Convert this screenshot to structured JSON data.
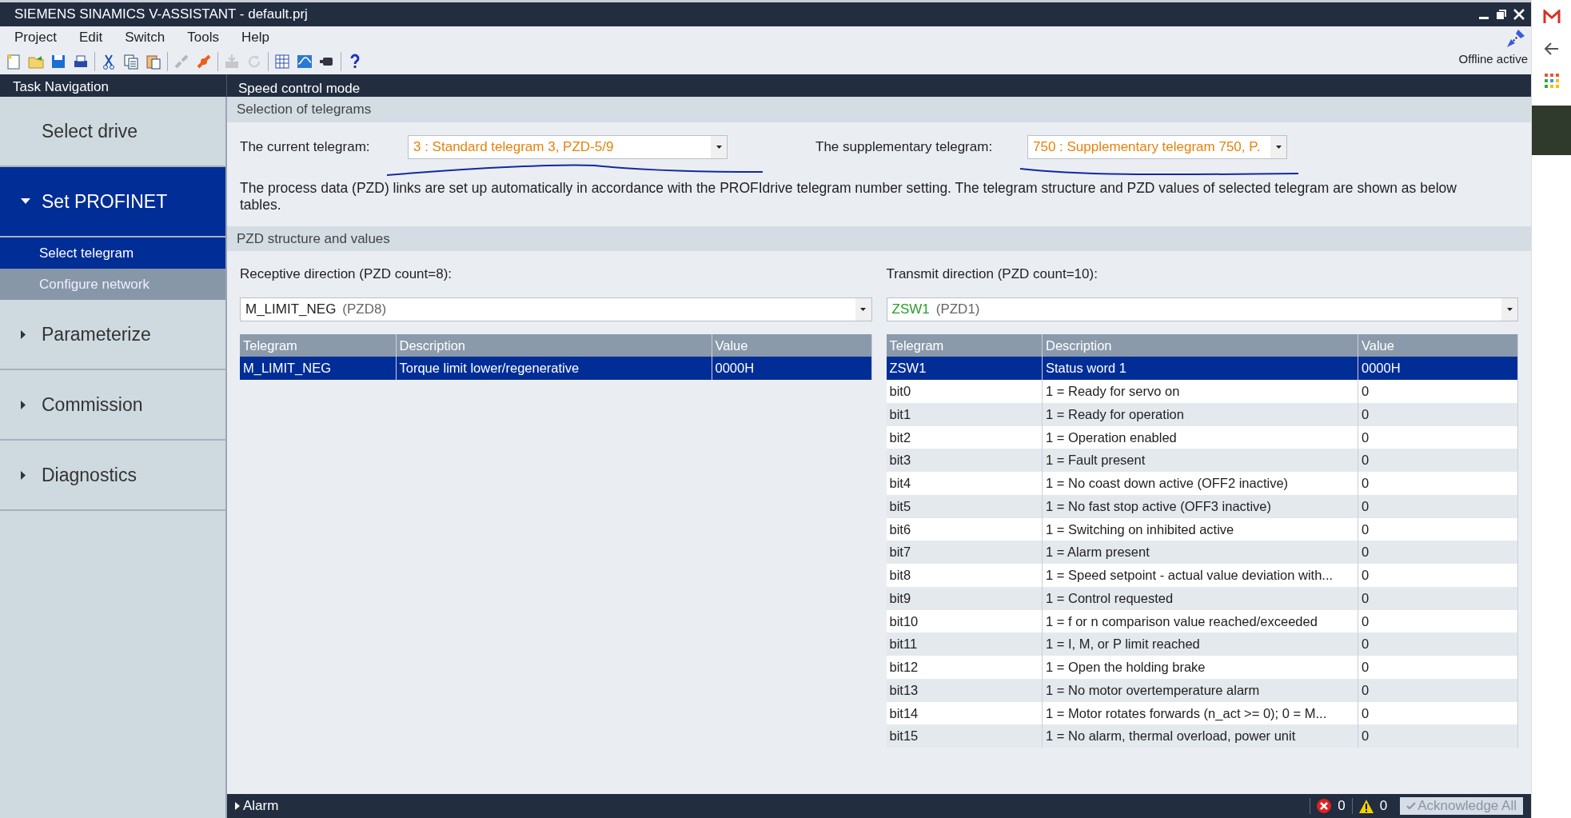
{
  "window": {
    "title": "SIEMENS SINAMICS V-ASSISTANT - default.prj"
  },
  "menu": [
    "Project",
    "Edit",
    "Switch",
    "Tools",
    "Help"
  ],
  "toolbar": [
    {
      "kind": "new",
      "disabled": false
    },
    {
      "kind": "open",
      "disabled": false
    },
    {
      "kind": "save",
      "disabled": false
    },
    {
      "kind": "print",
      "disabled": false
    },
    {
      "kind": "sep"
    },
    {
      "kind": "cut",
      "disabled": false
    },
    {
      "kind": "copy",
      "disabled": false
    },
    {
      "kind": "paste",
      "disabled": false
    },
    {
      "kind": "sep"
    },
    {
      "kind": "connect",
      "disabled": true
    },
    {
      "kind": "disconnect",
      "disabled": false
    },
    {
      "kind": "sep"
    },
    {
      "kind": "rom",
      "disabled": true
    },
    {
      "kind": "redo",
      "disabled": true
    },
    {
      "kind": "sep"
    },
    {
      "kind": "table",
      "disabled": false
    },
    {
      "kind": "trace",
      "disabled": false
    },
    {
      "kind": "motor",
      "disabled": false
    },
    {
      "kind": "sep"
    },
    {
      "kind": "help",
      "disabled": false
    }
  ],
  "connection_status": "Offline active",
  "task_navigation": {
    "title": "Task Navigation",
    "items": [
      {
        "label": "Select drive",
        "kind": "leaf",
        "selected": false
      },
      {
        "label": "Set PROFINET",
        "kind": "group",
        "expanded": true,
        "selected": true,
        "children": [
          {
            "label": "Select telegram",
            "selected": true
          },
          {
            "label": "Configure network",
            "selected": false
          }
        ]
      },
      {
        "label": "Parameterize",
        "kind": "group",
        "expanded": false,
        "selected": false
      },
      {
        "label": "Commission",
        "kind": "group",
        "expanded": false,
        "selected": false
      },
      {
        "label": "Diagnostics",
        "kind": "group",
        "expanded": false,
        "selected": false
      }
    ]
  },
  "page_title": "Speed control mode",
  "telegram_section": {
    "title": "Selection of telegrams",
    "current": {
      "label": "The current telegram:",
      "value": "3 : Standard telegram 3, PZD-5/9"
    },
    "supplementary": {
      "label": "The supplementary telegram:",
      "value": "750 : Supplementary telegram 750, P."
    },
    "description": "The process data (PZD) links are set up automatically in accordance with the PROFIdrive telegram number setting. The telegram structure and PZD values of selected telegram are shown as below tables."
  },
  "pzd_section": {
    "title": "PZD structure and values",
    "receive": {
      "label": "Receptive direction (PZD count=8):",
      "selector": {
        "name": "M_LIMIT_NEG",
        "pzd": "(PZD8)"
      },
      "columns": [
        "Telegram",
        "Description",
        "Value"
      ],
      "rows": [
        {
          "cells": [
            "M_LIMIT_NEG",
            "Torque limit lower/regenerative",
            "0000H"
          ],
          "selected": true
        }
      ]
    },
    "transmit": {
      "label": "Transmit direction (PZD count=10):",
      "selector": {
        "name": "ZSW1",
        "pzd": "(PZD1)"
      },
      "columns": [
        "Telegram",
        "Description",
        "Value"
      ],
      "rows": [
        {
          "cells": [
            "ZSW1",
            "Status word 1",
            "0000H"
          ],
          "selected": true
        },
        {
          "cells": [
            "bit0",
            "1 = Ready for servo on",
            "0"
          ],
          "selected": false
        },
        {
          "cells": [
            "bit1",
            "1 = Ready for operation",
            "0"
          ],
          "selected": false
        },
        {
          "cells": [
            "bit2",
            "1 = Operation enabled",
            "0"
          ],
          "selected": false
        },
        {
          "cells": [
            "bit3",
            "1 = Fault present",
            "0"
          ],
          "selected": false
        },
        {
          "cells": [
            "bit4",
            "1 = No coast down active (OFF2 inactive)",
            "0"
          ],
          "selected": false
        },
        {
          "cells": [
            "bit5",
            "1 = No fast stop active (OFF3 inactive)",
            "0"
          ],
          "selected": false
        },
        {
          "cells": [
            "bit6",
            "1 = Switching on inhibited active",
            "0"
          ],
          "selected": false
        },
        {
          "cells": [
            "bit7",
            "1 = Alarm present",
            "0"
          ],
          "selected": false
        },
        {
          "cells": [
            "bit8",
            "1 = Speed setpoint - actual value deviation with...",
            "0"
          ],
          "selected": false
        },
        {
          "cells": [
            "bit9",
            "1 = Control requested",
            "0"
          ],
          "selected": false
        },
        {
          "cells": [
            "bit10",
            "1 = f or n comparison value reached/exceeded",
            "0"
          ],
          "selected": false
        },
        {
          "cells": [
            "bit11",
            "1 = I, M, or P limit reached",
            "0"
          ],
          "selected": false
        },
        {
          "cells": [
            "bit12",
            "1 = Open the holding brake",
            "0"
          ],
          "selected": false
        },
        {
          "cells": [
            "bit13",
            "1 = No motor overtemperature alarm",
            "0"
          ],
          "selected": false
        },
        {
          "cells": [
            "bit14",
            "1 = Motor rotates forwards (n_act >= 0); 0 = M...",
            "0"
          ],
          "selected": false
        },
        {
          "cells": [
            "bit15",
            "1 = No alarm, thermal overload, power unit",
            "0"
          ],
          "selected": false
        }
      ]
    }
  },
  "alarm_bar": {
    "label": "Alarm",
    "expanded": false,
    "errors": "0",
    "warnings": "0",
    "acknowledge": {
      "label": "Acknowledge All",
      "disabled": true
    }
  }
}
